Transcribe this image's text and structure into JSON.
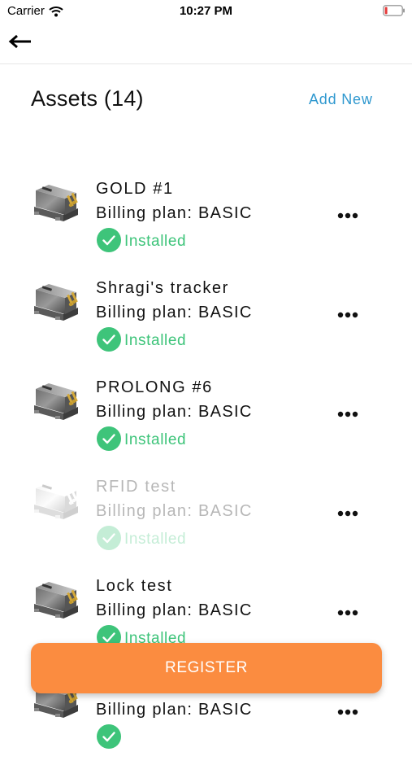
{
  "status_bar": {
    "carrier": "Carrier",
    "time": "10:27 PM"
  },
  "header": {
    "title": "Assets (14)",
    "add_new": "Add New"
  },
  "assets": [
    {
      "name": "GOLD #1",
      "plan": "Billing plan: BASIC",
      "status": "Installed"
    },
    {
      "name": "Shragi's tracker",
      "plan": "Billing plan: BASIC",
      "status": "Installed"
    },
    {
      "name": "PROLONG #6",
      "plan": "Billing plan: BASIC",
      "status": "Installed"
    },
    {
      "name": "RFID test",
      "plan": "Billing plan: BASIC",
      "status": "Installed"
    },
    {
      "name": "Lock test",
      "plan": "Billing plan: BASIC",
      "status": "Installed"
    },
    {
      "name": "",
      "plan": "Billing plan: BASIC",
      "status": ""
    }
  ],
  "register_label": "REGISTER",
  "colors": {
    "accent_blue": "#2f98cf",
    "status_green": "#3ec47a",
    "register_orange": "#fb8c40"
  },
  "icons": [
    "wifi-icon",
    "battery-icon",
    "back-arrow-icon",
    "device-icon",
    "check-circle-icon",
    "more-icon"
  ]
}
